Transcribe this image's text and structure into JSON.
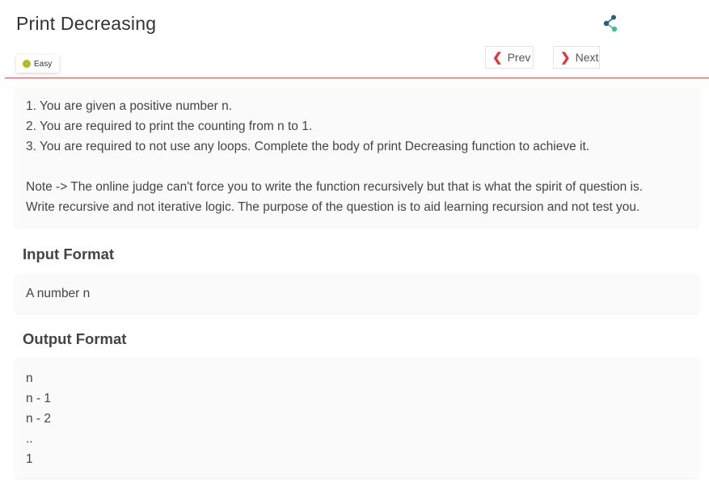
{
  "header": {
    "title": "Print Decreasing",
    "difficulty": "Easy",
    "difficulty_color": "#b5ba22",
    "share_icon": "share-icon"
  },
  "nav": {
    "prev_label": "Prev",
    "next_label": "Next",
    "accent_color": "#e2363b"
  },
  "description": {
    "lines": [
      "1. You are given a positive number n.",
      "2. You are required to print the counting from n to 1.",
      "3. You are required to not use any loops. Complete the body of print Decreasing function to achieve it."
    ],
    "note_lines": [
      "Note -> The online judge can't force you to write the function recursively but that is what the spirit of question is.",
      "Write recursive and not iterative logic. The purpose of the question is to aid learning recursion and not test you."
    ]
  },
  "input_format": {
    "heading": "Input Format",
    "text": "A number n"
  },
  "output_format": {
    "heading": "Output Format",
    "lines": [
      "n",
      "n - 1",
      "n - 2",
      "..",
      "1"
    ]
  }
}
